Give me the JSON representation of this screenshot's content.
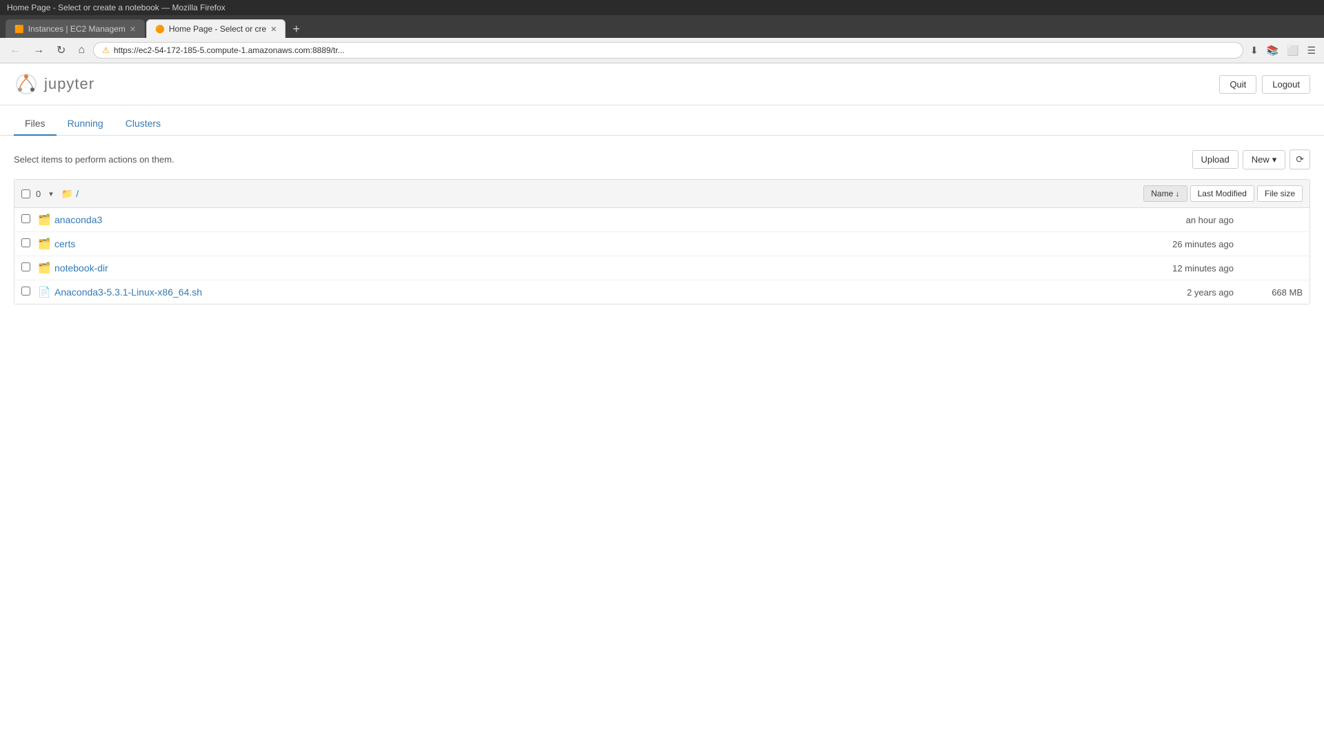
{
  "browser": {
    "titlebar": "Home Page - Select or create a notebook — Mozilla Firefox",
    "tabs": [
      {
        "id": "tab-1",
        "label": "Instances | EC2 Managem",
        "icon": "🟧",
        "active": false
      },
      {
        "id": "tab-2",
        "label": "Home Page - Select or cre",
        "icon": "🟠",
        "active": true
      }
    ],
    "new_tab_label": "+",
    "url": "https://ec2-54-172-185-5.compute-1.amazonaws.com:8889/tr...",
    "lock_icon": "⚠",
    "nav": {
      "back": "←",
      "forward": "→",
      "reload": "↻",
      "home": "⌂"
    }
  },
  "jupyter": {
    "logo_text": "jupyter",
    "quit_label": "Quit",
    "logout_label": "Logout"
  },
  "tabs": {
    "files_label": "Files",
    "running_label": "Running",
    "clusters_label": "Clusters",
    "active_tab": "files"
  },
  "file_browser": {
    "select_hint": "Select items to perform actions on them.",
    "upload_label": "Upload",
    "new_label": "New",
    "refresh_icon": "⟳",
    "columns": {
      "name_label": "Name",
      "sort_icon": "↓",
      "last_modified_label": "Last Modified",
      "file_size_label": "File size"
    },
    "breadcrumb": {
      "folder_icon": "📁",
      "path": "/"
    },
    "item_count": "0",
    "files": [
      {
        "id": "anaconda3",
        "type": "folder",
        "name": "anaconda3",
        "modified": "an hour ago",
        "size": ""
      },
      {
        "id": "certs",
        "type": "folder",
        "name": "certs",
        "modified": "26 minutes ago",
        "size": ""
      },
      {
        "id": "notebook-dir",
        "type": "folder",
        "name": "notebook-dir",
        "modified": "12 minutes ago",
        "size": ""
      },
      {
        "id": "anaconda3-sh",
        "type": "file",
        "name": "Anaconda3-5.3.1-Linux-x86_64.sh",
        "modified": "2 years ago",
        "size": "668 MB"
      }
    ]
  }
}
